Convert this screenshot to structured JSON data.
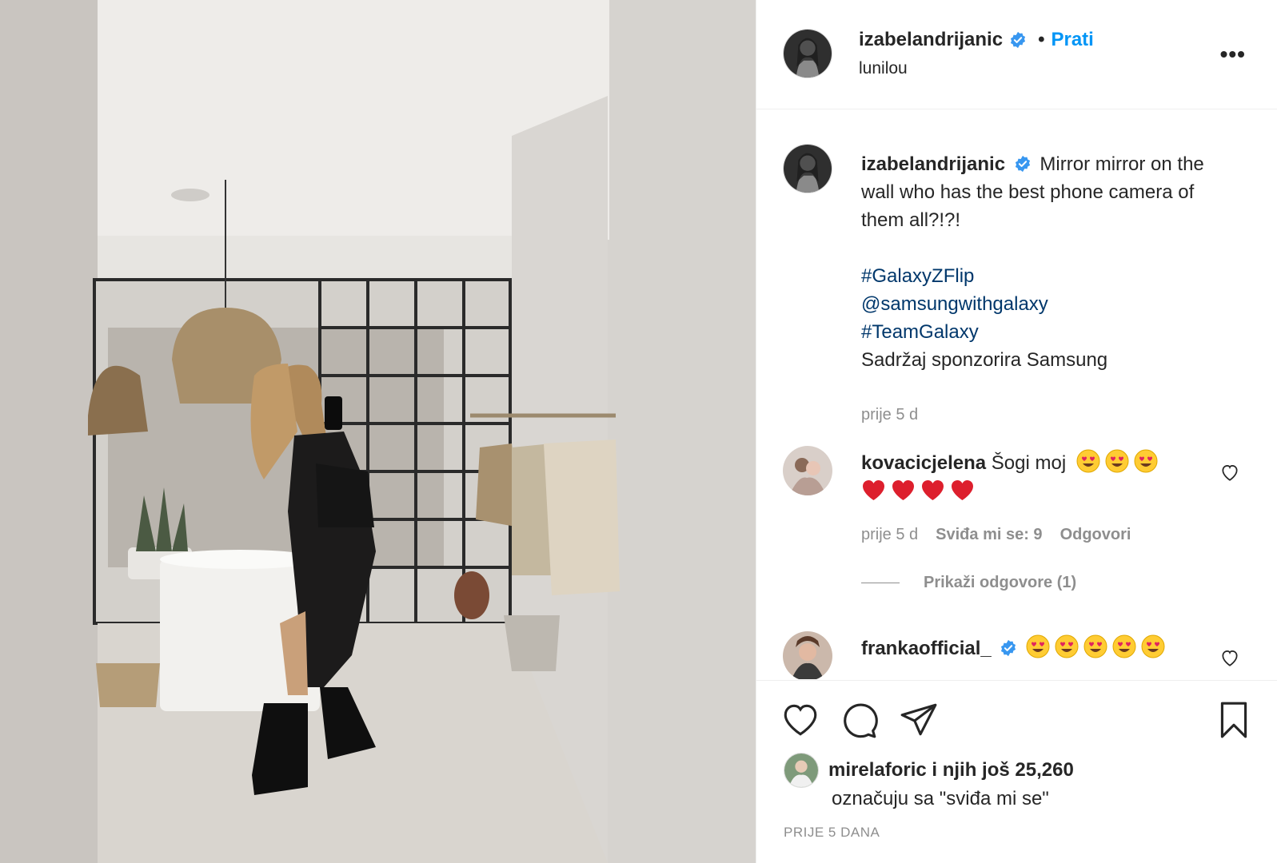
{
  "post": {
    "username": "izabelandrijanic",
    "follow_label": "Prati",
    "separator": "•",
    "location": "lunilou",
    "more_label": "•••",
    "photo_alt_icon": "mirror-selfie-photo"
  },
  "caption": {
    "username": "izabelandrijanic",
    "text": "Mirror mirror on the wall who has the best phone camera of them all?!?!",
    "tags": [
      "#GalaxyZFlip",
      "@samsungwithgalaxy",
      "#TeamGalaxy"
    ],
    "sponsor": "Sadržaj sponzorira Samsung",
    "time": "prije 5 d"
  },
  "comments": [
    {
      "username": "kovacicjelena",
      "text": "Šogi moj",
      "time": "prije 5 d",
      "likes": "Sviđa mi se: 9",
      "reply_label": "Odgovori",
      "view_replies": "Prikaži odgovore (1)"
    },
    {
      "username": "frankaofficial_"
    }
  ],
  "likes": {
    "user": "mirelaforic",
    "rest": "i njih još 25,260",
    "line2": "označuju sa \"sviđa mi se\""
  },
  "date": "PRIJE 5 DANA",
  "colors": {
    "link": "#0095f6",
    "hashtag": "#00376b",
    "meta": "#8e8e8e",
    "verified": "#3897f0",
    "heart_emoji": "#e0245e"
  }
}
